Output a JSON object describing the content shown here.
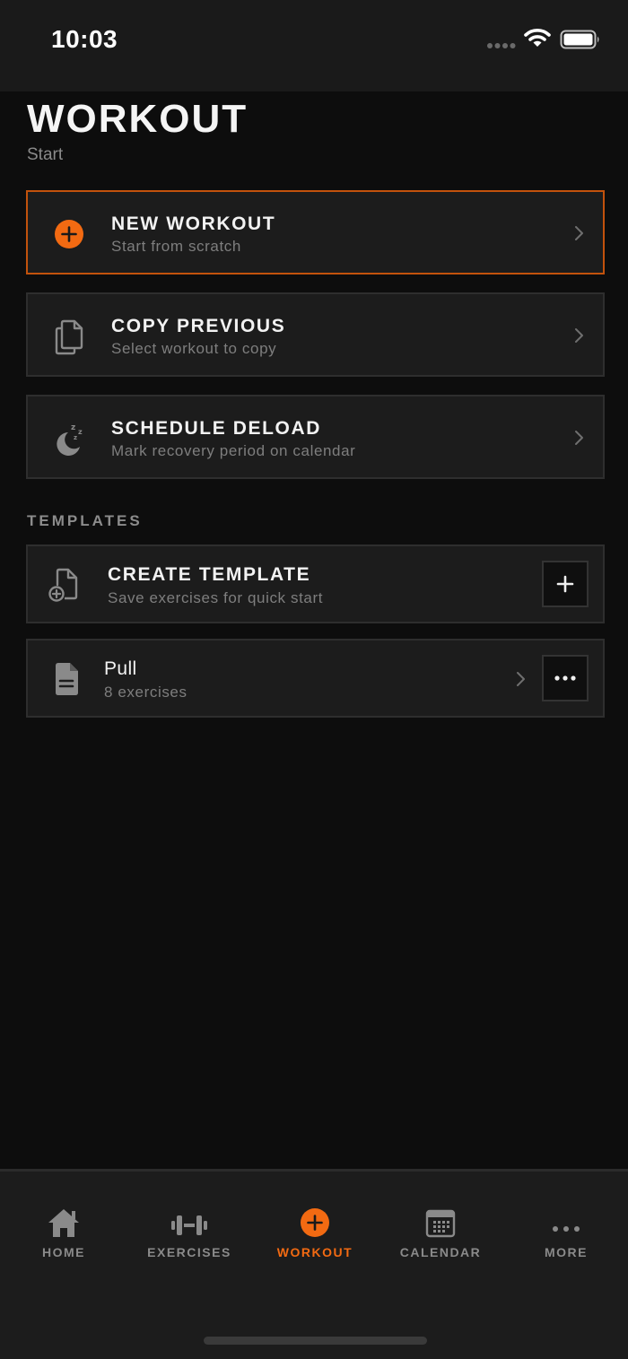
{
  "status_bar": {
    "time": "10:03"
  },
  "header": {
    "title": "WORKOUT",
    "subtitle": "Start"
  },
  "actions": [
    {
      "title": "NEW WORKOUT",
      "subtitle": "Start from scratch",
      "icon": "plus-circle-icon"
    },
    {
      "title": "COPY PREVIOUS",
      "subtitle": "Select workout to copy",
      "icon": "copy-document-icon"
    },
    {
      "title": "SCHEDULE DELOAD",
      "subtitle": "Mark recovery period on calendar",
      "icon": "moon-sleep-icon"
    }
  ],
  "templates": {
    "section_label": "TEMPLATES",
    "create": {
      "title": "CREATE TEMPLATE",
      "subtitle": "Save exercises for quick start"
    },
    "items": [
      {
        "title": "Pull",
        "subtitle": "8 exercises"
      }
    ]
  },
  "tab_bar": {
    "tabs": [
      {
        "label": "HOME",
        "icon": "home-icon",
        "active": false
      },
      {
        "label": "EXERCISES",
        "icon": "dumbbell-icon",
        "active": false
      },
      {
        "label": "WORKOUT",
        "icon": "plus-circle-icon",
        "active": true
      },
      {
        "label": "CALENDAR",
        "icon": "calendar-icon",
        "active": false
      },
      {
        "label": "MORE",
        "icon": "more-dots-icon",
        "active": false
      }
    ]
  },
  "colors": {
    "accent": "#f26a12",
    "background": "#0d0d0d",
    "card": "#1c1c1c",
    "accent_border": "#c2520c"
  }
}
